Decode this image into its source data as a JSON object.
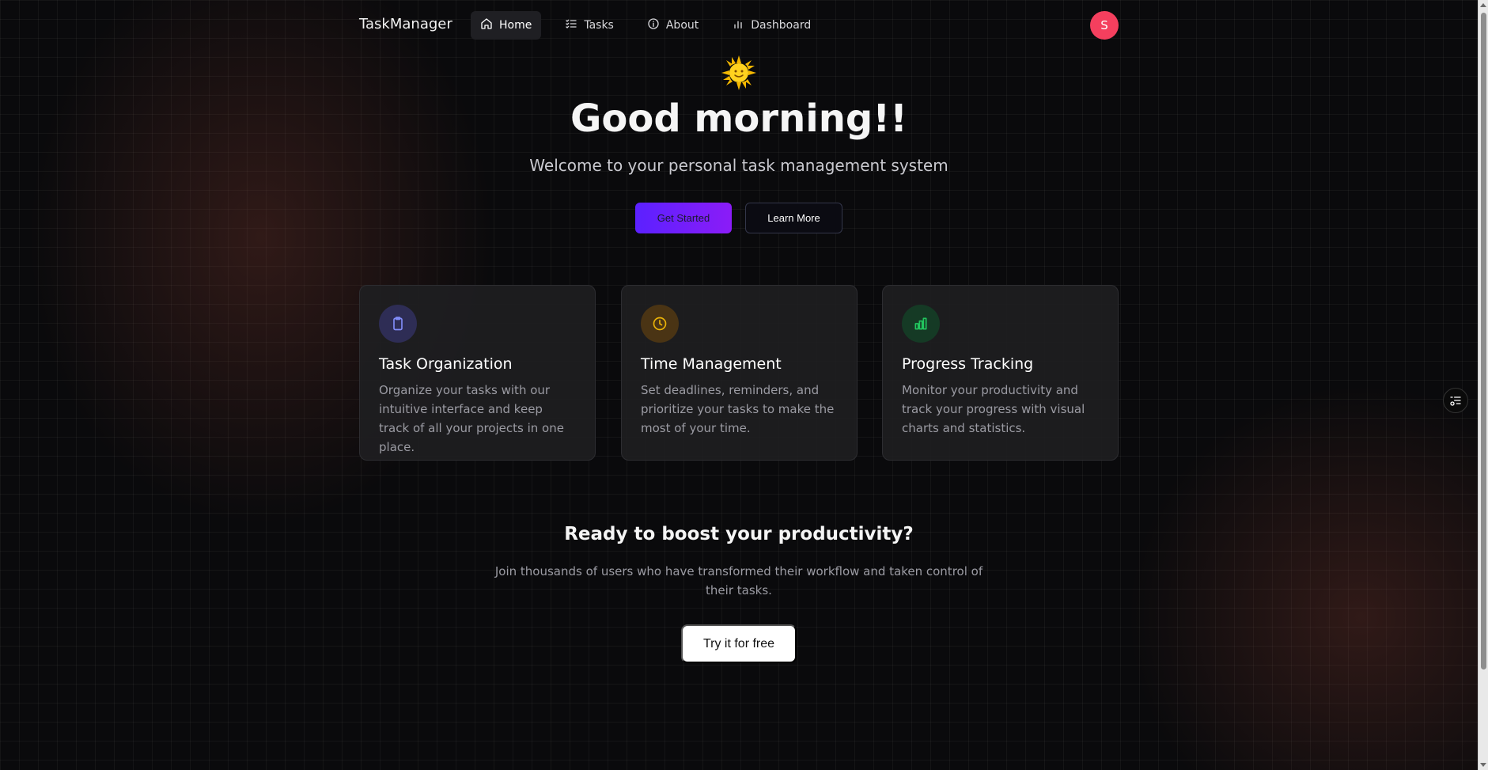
{
  "nav": {
    "brand": "TaskManager",
    "items": [
      {
        "label": "Home",
        "icon": "home-icon",
        "active": true
      },
      {
        "label": "Tasks",
        "icon": "list-check-icon",
        "active": false
      },
      {
        "label": "About",
        "icon": "info-icon",
        "active": false
      },
      {
        "label": "Dashboard",
        "icon": "bar-chart-icon",
        "active": false
      }
    ],
    "avatar_initial": "S",
    "avatar_color": "#f43f5e"
  },
  "hero": {
    "emoji_icon": "sun-emoji-icon",
    "title": "Good morning!!",
    "subtitle": "Welcome to your personal task management system",
    "primary_button": "Get Started",
    "secondary_button": "Learn More"
  },
  "features": [
    {
      "title": "Task Organization",
      "description": "Organize your tasks with our intuitive interface and keep track of all your projects in one place.",
      "icon": "clipboard-icon",
      "accent": "#818cf8"
    },
    {
      "title": "Time Management",
      "description": "Set deadlines, reminders, and prioritize your tasks to make the most of your time.",
      "icon": "clock-icon",
      "accent": "#eab308"
    },
    {
      "title": "Progress Tracking",
      "description": "Monitor your productivity and track your progress with visual charts and statistics.",
      "icon": "bar-chart-icon",
      "accent": "#22c55e"
    }
  ],
  "cta": {
    "title": "Ready to boost your productivity?",
    "text": "Join thousands of users who have transformed their workflow and taken control of their tasks.",
    "button": "Try it for free"
  },
  "colors": {
    "primary_gradient_start": "#5b21ff",
    "primary_gradient_end": "#8b1cf7",
    "background": "#0a0a0c"
  }
}
